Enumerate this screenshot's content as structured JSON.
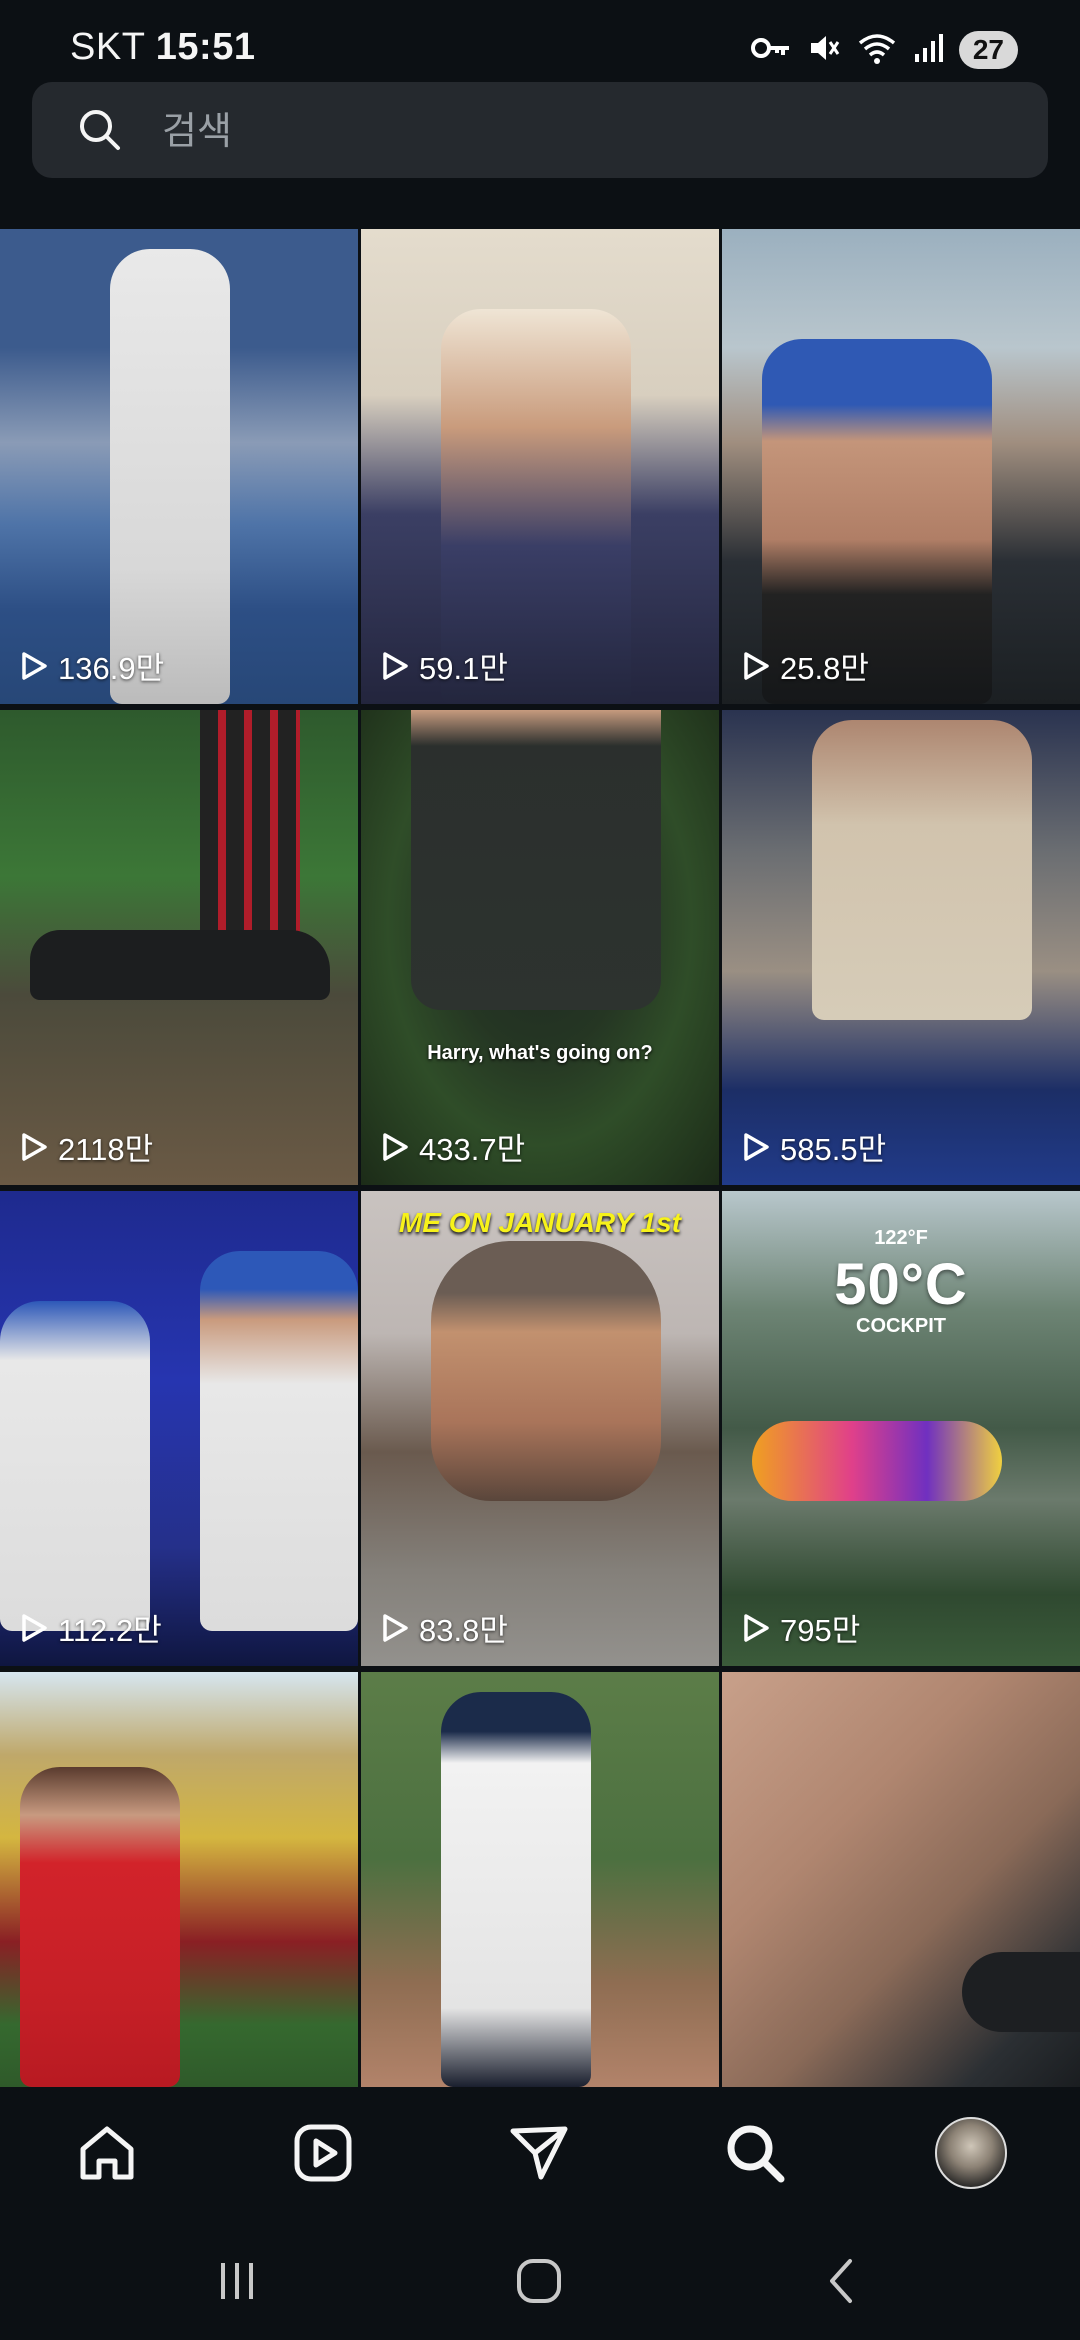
{
  "status_bar": {
    "carrier": "SKT",
    "time": "15:51",
    "icons": [
      "vpn-key-icon",
      "mute-icon",
      "wifi-icon",
      "signal-icon"
    ],
    "battery": "27"
  },
  "search": {
    "placeholder": "검색",
    "value": ""
  },
  "grid": {
    "tiles": [
      {
        "views": "136.9만"
      },
      {
        "views": "59.1만"
      },
      {
        "views": "25.8만"
      },
      {
        "views": "2118만"
      },
      {
        "views": "433.7만",
        "caption": "Harry, what's going on?"
      },
      {
        "views": "585.5만"
      },
      {
        "views": "112.2만"
      },
      {
        "views": "83.8만",
        "caption": "ME ON JANUARY 1st"
      },
      {
        "views": "795만",
        "caption_top": "122°F",
        "caption_big": "50°C",
        "caption_sub": "COCKPIT"
      },
      {
        "views": ""
      },
      {
        "views": ""
      },
      {
        "views": ""
      }
    ]
  },
  "bottom_nav": {
    "items": [
      "home-icon",
      "reels-icon",
      "messages-icon",
      "search-icon",
      "profile-avatar"
    ],
    "active": "search-icon"
  },
  "system_nav": {
    "items": [
      "recent-apps-icon",
      "home-button-icon",
      "back-icon"
    ]
  }
}
